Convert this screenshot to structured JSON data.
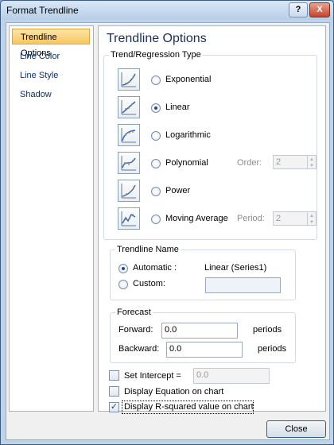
{
  "window": {
    "title": "Format Trendline",
    "help_glyph": "?",
    "close_glyph": "X"
  },
  "nav": {
    "items": [
      {
        "label": "Trendline Options",
        "selected": true
      },
      {
        "label": "Line Color",
        "selected": false
      },
      {
        "label": "Line Style",
        "selected": false
      },
      {
        "label": "Shadow",
        "selected": false
      }
    ]
  },
  "content": {
    "title": "Trendline Options",
    "type_group": {
      "title": "Trend/Regression Type",
      "options": [
        {
          "label": "Exponential",
          "checked": false,
          "icon": "exponential-trendline-icon"
        },
        {
          "label": "Linear",
          "checked": true,
          "icon": "linear-trendline-icon"
        },
        {
          "label": "Logarithmic",
          "checked": false,
          "icon": "logarithmic-trendline-icon"
        },
        {
          "label": "Polynomial",
          "checked": false,
          "icon": "polynomial-trendline-icon"
        },
        {
          "label": "Power",
          "checked": false,
          "icon": "power-trendline-icon"
        },
        {
          "label": "Moving Average",
          "checked": false,
          "icon": "moving-average-trendline-icon"
        }
      ],
      "order_label": "Order:",
      "order_value": "2",
      "period_label": "Period:",
      "period_value": "2"
    },
    "name_group": {
      "title": "Trendline Name",
      "automatic_label": "Automatic :",
      "automatic_value": "Linear (Series1)",
      "custom_label": "Custom:",
      "custom_value": ""
    },
    "forecast_group": {
      "title": "Forecast",
      "forward_label": "Forward:",
      "forward_value": "0.0",
      "backward_label": "Backward:",
      "backward_value": "0.0",
      "unit": "periods"
    },
    "set_intercept_label": "Set Intercept =",
    "set_intercept_value": "0.0",
    "display_equation_label": "Display Equation on chart",
    "display_rsquared_label": "Display R-squared value on chart",
    "display_rsquared_checked": true
  },
  "footer": {
    "close_label": "Close"
  },
  "colors": {
    "accent": "#23488a",
    "selected_nav": "#f8c55f"
  }
}
